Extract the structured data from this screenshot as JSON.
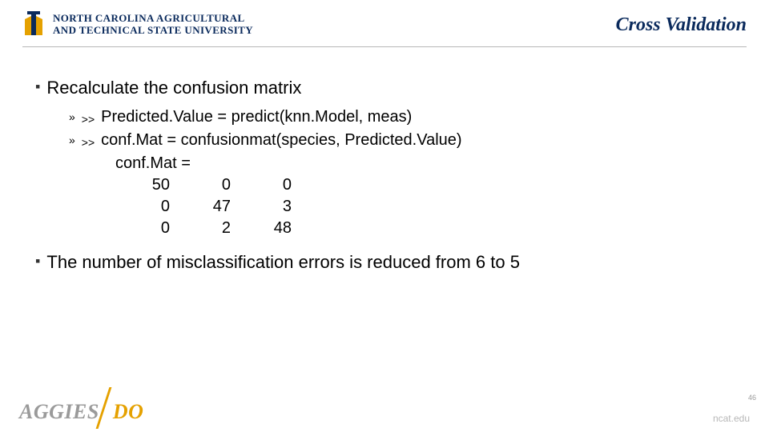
{
  "header": {
    "logo_line1": "NORTH CAROLINA AGRICULTURAL",
    "logo_line2": "AND TECHNICAL STATE UNIVERSITY",
    "title": "Cross Validation"
  },
  "content": {
    "bullet1": "Recalculate the confusion matrix",
    "sub1_prompt": ">>",
    "sub1_code": "Predicted.Value = predict(knn.Model, meas)",
    "sub2_prompt": ">>",
    "sub2_code": "conf.Mat = confusionmat(species, Predicted.Value)",
    "confmat_label": "conf.Mat =",
    "bullet2": "The number of misclassification errors is reduced from 6 to 5"
  },
  "matrix": {
    "rows": [
      [
        "50",
        "0",
        "0"
      ],
      [
        "0",
        "47",
        "3"
      ],
      [
        "0",
        "2",
        "48"
      ]
    ]
  },
  "footer": {
    "aggies": "AGGIES",
    "do": "DO",
    "site": "ncat.edu",
    "page": "46"
  }
}
